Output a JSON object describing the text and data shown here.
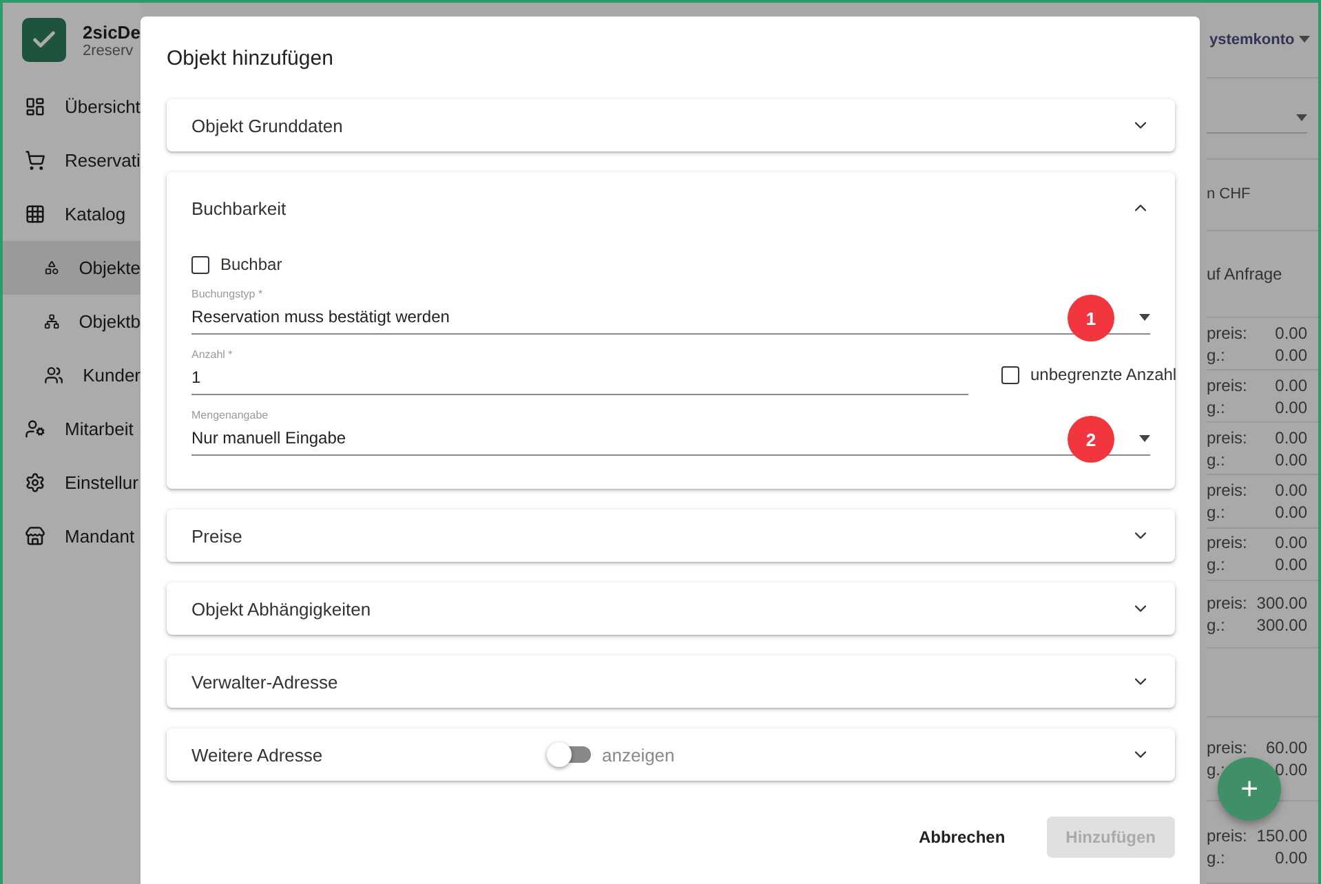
{
  "app": {
    "name": "2sicDe",
    "subtitle": "2reserv",
    "account": "ystemkonto"
  },
  "sidebar": {
    "items": [
      {
        "label": "Übersicht",
        "selected": false
      },
      {
        "label": "Reservati",
        "selected": false
      },
      {
        "label": "Katalog",
        "selected": false,
        "children": [
          {
            "label": "Objekte",
            "selected": true
          },
          {
            "label": "Objektb",
            "selected": false
          },
          {
            "label": "Kunder",
            "selected": false
          }
        ]
      },
      {
        "label": "Mitarbeit",
        "selected": false
      },
      {
        "label": "Einstellur",
        "selected": false
      },
      {
        "label": "Mandant",
        "selected": false
      }
    ]
  },
  "background_list": {
    "header_1": "n CHF",
    "header_2": "uf Anfrage",
    "rows": [
      {
        "label_1": "preis:",
        "value_1": "0.00",
        "label_2": "g.:",
        "value_2": "0.00"
      },
      {
        "label_1": "preis:",
        "value_1": "0.00",
        "label_2": "g.:",
        "value_2": "0.00"
      },
      {
        "label_1": "preis:",
        "value_1": "0.00",
        "label_2": "g.:",
        "value_2": "0.00"
      },
      {
        "label_1": "preis:",
        "value_1": "0.00",
        "label_2": "g.:",
        "value_2": "0.00"
      },
      {
        "label_1": "preis:",
        "value_1": "0.00",
        "label_2": "g.:",
        "value_2": "0.00"
      },
      {
        "label_1": "preis:",
        "value_1": "300.00",
        "label_2": "g.:",
        "value_2": "300.00"
      },
      {
        "kind": "empty"
      },
      {
        "label_1": "preis:",
        "value_1": "60.00",
        "label_2": "g.:",
        "value_2": "0.00"
      },
      {
        "label_1": "preis:",
        "value_1": "150.00",
        "label_2": "g.:",
        "value_2": "0.00"
      }
    ]
  },
  "fab": {
    "label": "+"
  },
  "dialog": {
    "title": "Objekt hinzufügen",
    "panels": [
      {
        "title": "Objekt Grunddaten",
        "expanded": false
      },
      {
        "title": "Buchbarkeit",
        "expanded": true,
        "fields": [
          {
            "kind": "checkbox",
            "label": "Buchbar",
            "checked": false
          },
          {
            "kind": "select",
            "label": "Buchungstyp *",
            "value": "Reservation muss bestätigt werden",
            "badge": "1"
          },
          {
            "kind": "input",
            "label": "Anzahl *",
            "value": "1",
            "checkbox": {
              "label": "unbegrenzte Anzahl",
              "checked": false
            }
          },
          {
            "kind": "select",
            "label": "Mengenangabe",
            "value": "Nur manuell Eingabe",
            "badge": "2"
          }
        ]
      },
      {
        "title": "Preise",
        "expanded": false
      },
      {
        "title": "Objekt Abhängigkeiten",
        "expanded": false
      },
      {
        "title": "Verwalter-Adresse",
        "expanded": false
      },
      {
        "title": "Weitere Adresse",
        "expanded": false,
        "toggle": {
          "label": "anzeigen",
          "on": false
        }
      }
    ],
    "buttons": [
      {
        "label": "Abbrechen",
        "disabled": false
      },
      {
        "label": "Hinzufügen",
        "disabled": true
      }
    ]
  }
}
